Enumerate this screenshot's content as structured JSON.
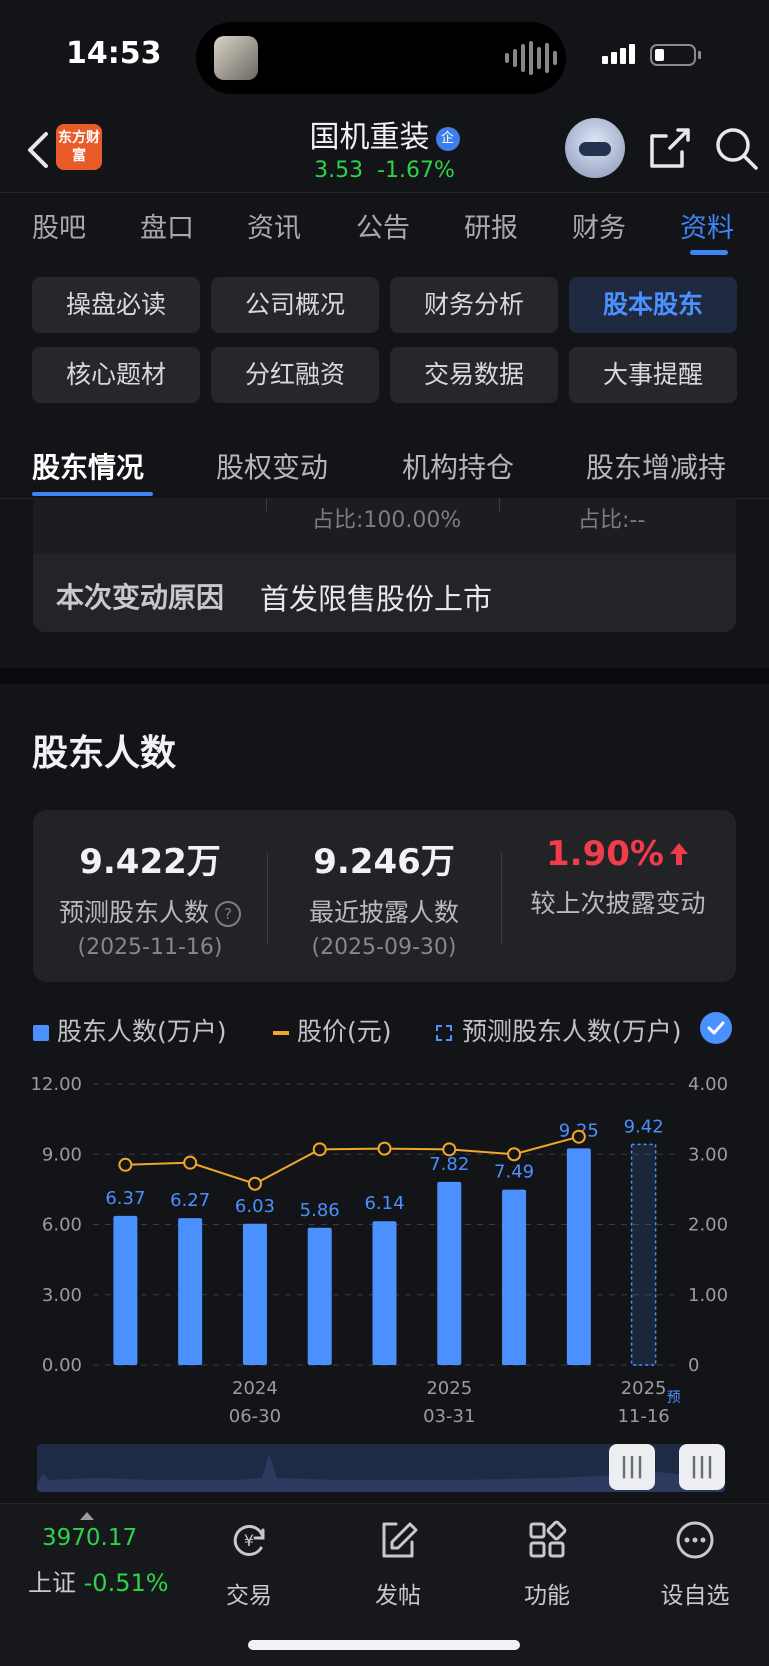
{
  "status_bar": {
    "time": "14:53"
  },
  "header": {
    "logo_text": "东方财富",
    "stock_name": "国机重装",
    "badge": "企",
    "price": "3.53",
    "change": "-1.67%"
  },
  "tabs": [
    "股吧",
    "盘口",
    "资讯",
    "公告",
    "研报",
    "财务",
    "资料"
  ],
  "grid_buttons": [
    "操盘必读",
    "公司概况",
    "财务分析",
    "股本股东",
    "核心题材",
    "分红融资",
    "交易数据",
    "大事提醒"
  ],
  "sub_tabs": [
    "股东情况",
    "股权变动",
    "机构持仓",
    "股东增减持"
  ],
  "prev_card": {
    "occupy_1": "占比:100.00%",
    "occupy_2": "占比:--",
    "reason_label": "本次变动原因",
    "reason_text": "首发限售股份上市"
  },
  "section_title": "股东人数",
  "stats": [
    {
      "value": "9.422万",
      "label": "预测股东人数",
      "date": "(2025-11-16)"
    },
    {
      "value": "9.246万",
      "label": "最近披露人数",
      "date": "(2025-09-30)"
    },
    {
      "value": "1.90%",
      "label": "较上次披露变动",
      "date": ""
    }
  ],
  "legend": {
    "bars": "股东人数(万户)",
    "line": "股价(元)",
    "forecast": "预测股东人数(万户)"
  },
  "chart_data": {
    "type": "bar",
    "values": [
      6.37,
      6.27,
      6.03,
      5.86,
      6.14,
      7.82,
      7.49,
      9.25,
      9.42
    ],
    "value_labels": [
      "6.37",
      "6.27",
      "6.03",
      "5.86",
      "6.14",
      "7.82",
      "7.49",
      "9.25",
      "9.42"
    ],
    "forecast_index": 8,
    "price": [
      2.85,
      2.88,
      2.58,
      3.07,
      3.08,
      3.07,
      3.0,
      3.25
    ],
    "left_ticks": [
      "12.00",
      "9.00",
      "6.00",
      "3.00",
      "0.00"
    ],
    "right_ticks": [
      "4.00",
      "3.00",
      "2.00",
      "1.00",
      "0"
    ],
    "ylim_left": [
      0,
      12
    ],
    "ylim_right": [
      0,
      4
    ],
    "x_labels": [
      {
        "year": "2024",
        "date": "06-30"
      },
      {
        "year": "2025",
        "date": "03-31"
      },
      {
        "year": "2025",
        "date": "11-16"
      }
    ],
    "forecast_mark": "预",
    "colors": {
      "bar": "#4b90ff",
      "line": "#f2a629"
    }
  },
  "bottom_bar": {
    "index_value": "3970.17",
    "index_name": "上证",
    "index_change": "-0.51%",
    "items": [
      "交易",
      "发帖",
      "功能",
      "设自选"
    ]
  }
}
